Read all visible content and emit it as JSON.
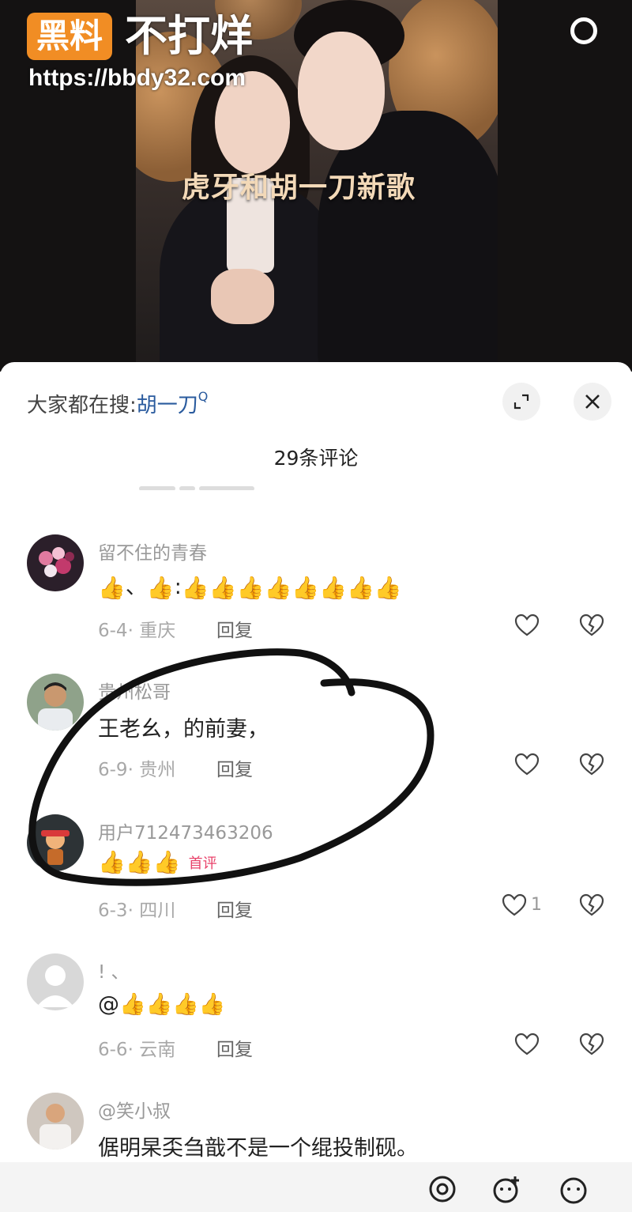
{
  "watermark": {
    "badge": "黑料",
    "text": "不打烊",
    "url": "https://bbdy32.com"
  },
  "video": {
    "caption": "虎牙和胡一刀新歌"
  },
  "panel": {
    "search_prefix": "大家都在搜:",
    "search_term": "胡一刀",
    "search_marker": "Q",
    "comment_count": "29条评论",
    "icons": {
      "expand": "expand-icon",
      "close": "close-icon"
    }
  },
  "comments": [
    {
      "username": "留不住的青春",
      "content_parts": [
        "👍",
        "、",
        "👍",
        ":",
        "👍👍👍👍👍👍👍👍"
      ],
      "date": "6-4",
      "location": "重庆",
      "reply": "回复",
      "likes": ""
    },
    {
      "username": "贵州松哥",
      "content": "王老幺，的前妻，",
      "date": "6-9",
      "location": "贵州",
      "reply": "回复",
      "likes": ""
    },
    {
      "username": "用户712473463206",
      "content": "👍👍👍",
      "badge": "首评",
      "date": "6-3",
      "location": "四川",
      "reply": "回复",
      "likes": "1"
    },
    {
      "username": "! 、",
      "content": "@👍👍👍👍",
      "date": "6-6",
      "location": "云南",
      "reply": "回复",
      "likes": ""
    },
    {
      "username": "@笑小叔",
      "content": "倨明杲奀刍戠不是一个绲投制砚。"
    }
  ],
  "bottom_bar": {
    "icons": [
      "at-icon",
      "emoji-plus-icon",
      "emoji-icon"
    ]
  },
  "colors": {
    "watermark_badge": "#f18d24",
    "search_term": "#2a5b9e",
    "first_badge": "#e8426a"
  }
}
